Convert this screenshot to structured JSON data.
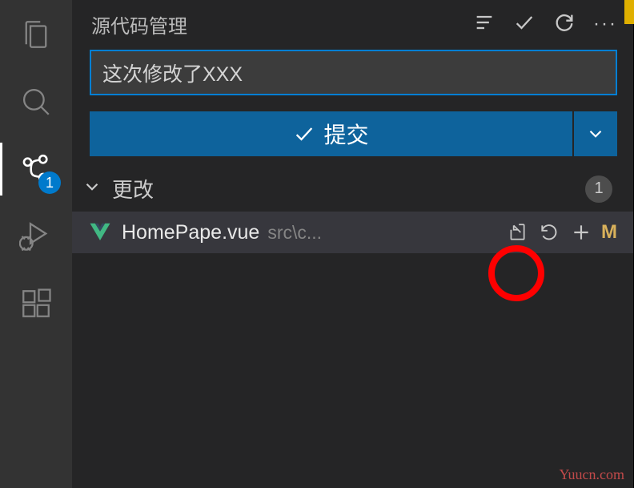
{
  "activitybar": {
    "scm_badge": "1"
  },
  "header": {
    "title": "源代码管理"
  },
  "commit": {
    "message": "这次修改了XXX",
    "button_label": "提交"
  },
  "changes": {
    "section_label": "更改",
    "count": "1",
    "files": [
      {
        "name": "HomePape.vue",
        "path": "src\\c...",
        "status": "M"
      }
    ]
  },
  "watermark": "Yuucn.com"
}
